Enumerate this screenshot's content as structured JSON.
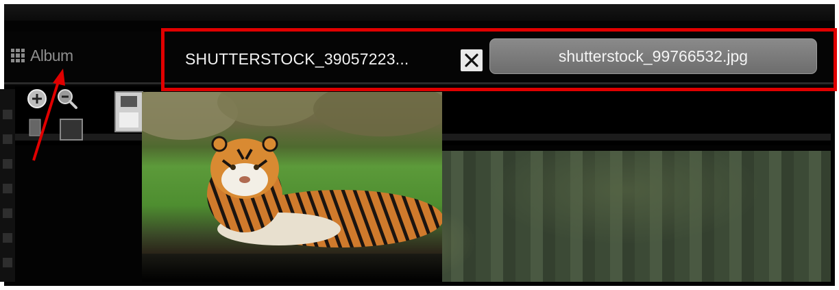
{
  "sidebar": {
    "album_label": "Album"
  },
  "tabs": [
    {
      "label": "SHUTTERSTOCK_39057223...",
      "active": false
    },
    {
      "label": "shutterstock_99766532.jpg",
      "active": true
    }
  ],
  "icons": {
    "album": "grid-icon",
    "close": "close-icon",
    "zoom_in": "zoom-in-icon",
    "zoom_out": "zoom-out-icon",
    "save": "floppy-disk-icon"
  },
  "colors": {
    "highlight": "#e00000",
    "arrow": "#e00000",
    "background": "#030303",
    "active_tab": "#7a7a7a"
  }
}
